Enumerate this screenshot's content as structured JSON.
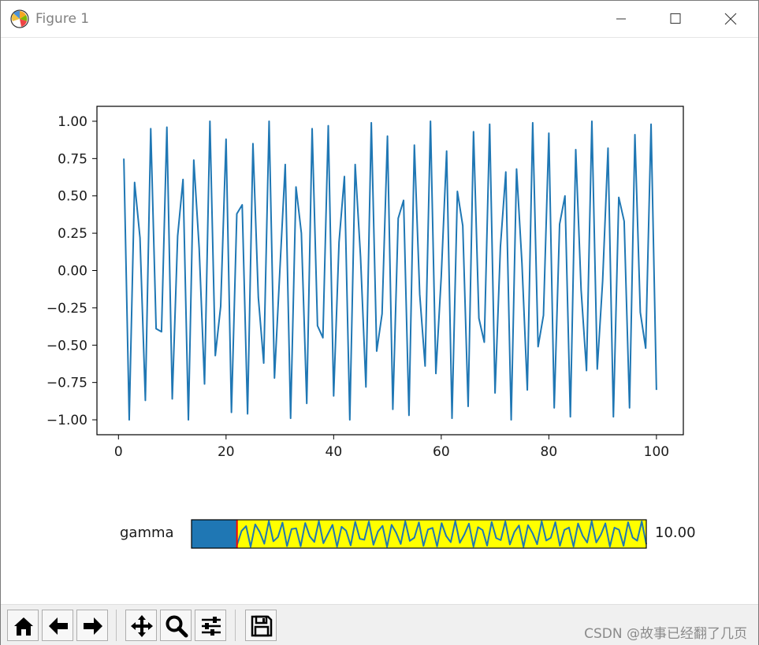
{
  "window": {
    "title": "Figure 1"
  },
  "slider": {
    "label": "gamma",
    "value_text": "10.00",
    "min": 0,
    "max": 100,
    "value": 10,
    "fill_color": "#1f77b4",
    "track_color": "#ffff00",
    "marker_color": "#ff0000"
  },
  "toolbar": {
    "buttons": [
      {
        "name": "home-button",
        "icon": "home-icon"
      },
      {
        "name": "back-button",
        "icon": "arrow-left-icon"
      },
      {
        "name": "forward-button",
        "icon": "arrow-right-icon"
      },
      {
        "name": "pan-button",
        "icon": "move-icon"
      },
      {
        "name": "zoom-button",
        "icon": "magnifier-icon"
      },
      {
        "name": "configure-subplots-button",
        "icon": "sliders-icon"
      },
      {
        "name": "save-button",
        "icon": "floppy-disk-icon"
      }
    ]
  },
  "watermark": "CSDN @故事已经翻了几页",
  "chart_data": {
    "type": "line",
    "title": "",
    "xlabel": "",
    "ylabel": "",
    "xlim": [
      -4,
      105
    ],
    "ylim": [
      -1.1,
      1.1
    ],
    "xticks": [
      0,
      20,
      40,
      60,
      80,
      100
    ],
    "xtick_labels": [
      "0",
      "20",
      "40",
      "60",
      "80",
      "100"
    ],
    "yticks": [
      1.0,
      0.75,
      0.5,
      0.25,
      0.0,
      -0.25,
      -0.5,
      -0.75,
      -1.0
    ],
    "ytick_labels": [
      "1.00",
      "0.75",
      "0.50",
      "0.25",
      "0.00",
      "−0.25",
      "−0.50",
      "−0.75",
      "−1.00"
    ],
    "grid": false,
    "series": [
      {
        "color": "#1f77b4",
        "x": [
          1,
          2,
          3,
          4,
          5,
          6,
          7,
          8,
          9,
          10,
          11,
          12,
          13,
          14,
          15,
          16,
          17,
          18,
          19,
          20,
          21,
          22,
          23,
          24,
          25,
          26,
          27,
          28,
          29,
          30,
          31,
          32,
          33,
          34,
          35,
          36,
          37,
          38,
          39,
          40,
          41,
          42,
          43,
          44,
          45,
          46,
          47,
          48,
          49,
          50,
          51,
          52,
          53,
          54,
          55,
          56,
          57,
          58,
          59,
          60,
          61,
          62,
          63,
          64,
          65,
          66,
          67,
          68,
          69,
          70,
          71,
          72,
          73,
          74,
          75,
          76,
          77,
          78,
          79,
          80,
          81,
          82,
          83,
          84,
          85,
          86,
          87,
          88,
          89,
          90,
          91,
          92,
          93,
          94,
          95,
          96,
          97,
          98,
          99,
          100
        ],
        "y": [
          0.75,
          -1.0,
          0.59,
          0.22,
          -0.87,
          0.95,
          -0.39,
          -0.41,
          0.96,
          -0.86,
          0.23,
          0.61,
          -1.0,
          0.74,
          0.15,
          -0.76,
          1.0,
          -0.57,
          -0.24,
          0.88,
          -0.95,
          0.38,
          0.44,
          -0.96,
          0.85,
          -0.18,
          -0.62,
          1.0,
          -0.72,
          0.0,
          0.71,
          -0.99,
          0.56,
          0.25,
          -0.89,
          0.95,
          -0.37,
          -0.45,
          0.97,
          -0.84,
          0.19,
          0.63,
          -1.0,
          0.71,
          0.09,
          -0.78,
          0.99,
          -0.54,
          -0.29,
          0.9,
          -0.93,
          0.35,
          0.47,
          -0.97,
          0.84,
          -0.16,
          -0.64,
          1.0,
          -0.69,
          -0.04,
          0.8,
          -0.99,
          0.53,
          0.3,
          -0.91,
          0.93,
          -0.32,
          -0.48,
          0.98,
          -0.82,
          0.16,
          0.66,
          -1.0,
          0.68,
          0.05,
          -0.8,
          0.99,
          -0.51,
          -0.3,
          0.92,
          -0.92,
          0.31,
          0.5,
          -0.98,
          0.81,
          -0.13,
          -0.67,
          1.0,
          -0.66,
          -0.07,
          0.82,
          -0.98,
          0.49,
          0.33,
          -0.92,
          0.91,
          -0.28,
          -0.52,
          0.98,
          -0.8
        ]
      }
    ]
  }
}
